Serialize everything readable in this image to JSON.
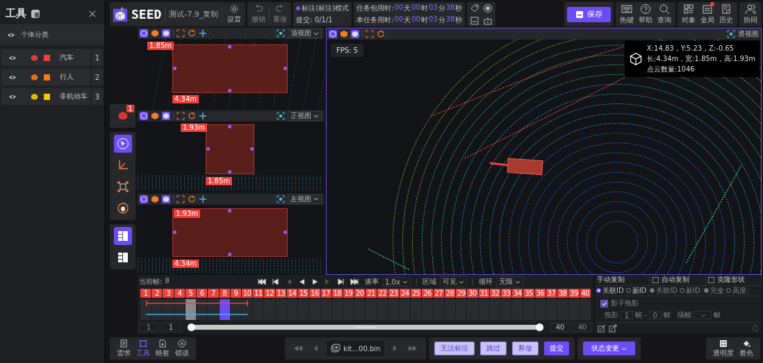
{
  "sidebar": {
    "title": "工具",
    "section": "个体分类",
    "categories": [
      {
        "name": "汽车",
        "color": "#f0403a",
        "count": "1"
      },
      {
        "name": "行人",
        "color": "#f57a12",
        "count": "2"
      },
      {
        "name": "非机动车",
        "color": "#f5c800",
        "count": "3"
      }
    ]
  },
  "header": {
    "logo": "SEED",
    "project": "测试-7.9_复制",
    "settings": "设置",
    "history": [
      {
        "label": "撤销",
        "disabled": true
      },
      {
        "label": "重做",
        "disabled": true
      }
    ],
    "mode": "标注(标注)模式",
    "submit": "提交: 0/1/1",
    "timers": [
      {
        "label": "任务包用时:",
        "parts": [
          {
            "value": "00",
            "unit": "天"
          },
          {
            "value": "00",
            "unit": "时"
          },
          {
            "value": "03",
            "unit": "分"
          },
          {
            "value": "38",
            "unit": "秒"
          }
        ]
      },
      {
        "label": "本任务用时:",
        "parts": [
          {
            "value": "00",
            "unit": "天"
          },
          {
            "value": "00",
            "unit": "时"
          },
          {
            "value": "03",
            "unit": "分"
          },
          {
            "value": "38",
            "unit": "秒"
          }
        ]
      }
    ],
    "save": "保存",
    "help_tools": [
      {
        "label": "热键"
      },
      {
        "label": "帮助"
      },
      {
        "label": "查询"
      }
    ],
    "panels": [
      {
        "label": "对象",
        "alert": false
      },
      {
        "label": "全局",
        "alert": true
      },
      {
        "label": "历史",
        "alert": false
      }
    ],
    "collab": "协同"
  },
  "tool_strip": {
    "badge": "1",
    "tools": [
      {
        "selected": true
      },
      {
        "selected": false
      },
      {
        "selected": false
      },
      {
        "selected": false
      }
    ],
    "layouts": [
      {
        "selected": true
      },
      {
        "selected": false
      }
    ]
  },
  "side_views": [
    {
      "view": "顶视图",
      "dims": [
        "1.85m",
        "4.34m"
      ]
    },
    {
      "view": "正视图",
      "dims": [
        "1.93m",
        "1.85m"
      ]
    },
    {
      "view": "左视图",
      "dims": [
        "1.93m",
        "4.34m"
      ]
    }
  ],
  "main_view": {
    "view": "透视图",
    "fps": "FPS: 5",
    "info": [
      "X:14.83，Y:5.23，Z:-0.65",
      "长:4.34m，宽:1.85m，高:1.93m",
      "点云数量:1046"
    ]
  },
  "timeline": {
    "current_label": "当前帧:",
    "current": "8",
    "controls": [
      {
        "disabled": false
      },
      {
        "disabled": false
      },
      {
        "disabled": true
      },
      {
        "disabled": false
      },
      {
        "disabled": false
      },
      {
        "disabled": true
      },
      {
        "disabled": false
      },
      {
        "disabled": false
      }
    ],
    "rate_label": "速率",
    "rate": "1.0x",
    "region_label": "区域",
    "region": "可见",
    "loop_label": "循环",
    "loop": "无限",
    "frames": [
      {
        "label": "1",
        "selected": false,
        "marked": false,
        "tracked": true
      },
      {
        "label": "2",
        "selected": false,
        "marked": false,
        "tracked": true
      },
      {
        "label": "3",
        "selected": false,
        "marked": false,
        "tracked": true
      },
      {
        "label": "4",
        "selected": false,
        "marked": false,
        "tracked": true
      },
      {
        "label": "5",
        "selected": false,
        "marked": true,
        "tracked": true
      },
      {
        "label": "6",
        "selected": false,
        "marked": false,
        "tracked": true
      },
      {
        "label": "7",
        "selected": false,
        "marked": false,
        "tracked": true
      },
      {
        "label": "8",
        "selected": true,
        "marked": false,
        "tracked": true
      },
      {
        "label": "9",
        "selected": false,
        "marked": false,
        "tracked": true
      },
      {
        "label": "10",
        "selected": false,
        "marked": false,
        "tracked": true
      },
      {
        "label": "11",
        "selected": false,
        "marked": false,
        "tracked": false
      },
      {
        "label": "12",
        "selected": false,
        "marked": false,
        "tracked": false
      },
      {
        "label": "13",
        "selected": false,
        "marked": false,
        "tracked": false
      },
      {
        "label": "14",
        "selected": false,
        "marked": false,
        "tracked": false
      },
      {
        "label": "15",
        "selected": false,
        "marked": false,
        "tracked": false
      },
      {
        "label": "16",
        "selected": false,
        "marked": false,
        "tracked": false
      },
      {
        "label": "17",
        "selected": false,
        "marked": false,
        "tracked": false
      },
      {
        "label": "18",
        "selected": false,
        "marked": false,
        "tracked": false
      },
      {
        "label": "19",
        "selected": false,
        "marked": false,
        "tracked": false
      },
      {
        "label": "20",
        "selected": false,
        "marked": false,
        "tracked": false
      },
      {
        "label": "21",
        "selected": false,
        "marked": false,
        "tracked": false
      },
      {
        "label": "22",
        "selected": false,
        "marked": false,
        "tracked": false
      },
      {
        "label": "23",
        "selected": false,
        "marked": false,
        "tracked": false
      },
      {
        "label": "24",
        "selected": false,
        "marked": false,
        "tracked": false
      },
      {
        "label": "25",
        "selected": false,
        "marked": false,
        "tracked": false
      },
      {
        "label": "26",
        "selected": false,
        "marked": false,
        "tracked": false
      },
      {
        "label": "27",
        "selected": false,
        "marked": false,
        "tracked": false
      },
      {
        "label": "28",
        "selected": false,
        "marked": false,
        "tracked": false
      },
      {
        "label": "29",
        "selected": false,
        "marked": false,
        "tracked": false
      },
      {
        "label": "30",
        "selected": false,
        "marked": false,
        "tracked": false
      },
      {
        "label": "31",
        "selected": false,
        "marked": false,
        "tracked": false
      },
      {
        "label": "32",
        "selected": false,
        "marked": false,
        "tracked": false
      },
      {
        "label": "33",
        "selected": false,
        "marked": false,
        "tracked": false
      },
      {
        "label": "34",
        "selected": false,
        "marked": false,
        "tracked": false
      },
      {
        "label": "35",
        "selected": false,
        "marked": false,
        "tracked": false
      },
      {
        "label": "36",
        "selected": false,
        "marked": false,
        "tracked": false
      },
      {
        "label": "37",
        "selected": false,
        "marked": false,
        "tracked": false
      },
      {
        "label": "38",
        "selected": false,
        "marked": false,
        "tracked": false
      },
      {
        "label": "39",
        "selected": false,
        "marked": false,
        "tracked": false
      },
      {
        "label": "40",
        "selected": false,
        "marked": false,
        "tracked": false
      }
    ],
    "range": {
      "first": "1",
      "start": "1",
      "end": "40",
      "last": "40",
      "level": 1
    }
  },
  "copy_panel": {
    "title": "手动复制",
    "options": [
      {
        "label": "自动复制",
        "checked": false
      },
      {
        "label": "克隆形状",
        "checked": false
      }
    ],
    "radio_groups": [
      {
        "disabled": false,
        "items": [
          {
            "label": "关联ID",
            "selected": true
          },
          {
            "label": "新ID",
            "selected": false
          }
        ]
      },
      {
        "disabled": true,
        "items": [
          {
            "label": "关联ID",
            "selected": true
          },
          {
            "label": "新ID",
            "selected": false
          }
        ]
      },
      {
        "disabled": true,
        "items": [
          {
            "label": "完全",
            "selected": true
          },
          {
            "label": "高度",
            "selected": false
          }
        ]
      }
    ],
    "shadow": {
      "label": "影子拖影",
      "checked": true,
      "drag_label": "拖影",
      "drag": "1",
      "unit_a": "帧 -",
      "back": "0",
      "unit_b": "帧",
      "skip_label": "隔帧",
      "unit_c": "帧"
    }
  },
  "footer": {
    "tabs": [
      {
        "label": "需求",
        "selected": false
      },
      {
        "label": "工具",
        "selected": true
      },
      {
        "label": "映射",
        "selected": false
      },
      {
        "label": "错误",
        "selected": false
      }
    ],
    "file": "kit...00.bin",
    "actions": [
      {
        "label": "无法标注",
        "kind": "outline"
      },
      {
        "label": "跳过",
        "kind": "outline"
      },
      {
        "label": "释放",
        "kind": "outline"
      },
      {
        "label": "提交",
        "kind": "primary"
      }
    ],
    "status": "状态变更",
    "display": [
      {
        "label": "透明度"
      },
      {
        "label": "着色"
      }
    ]
  }
}
